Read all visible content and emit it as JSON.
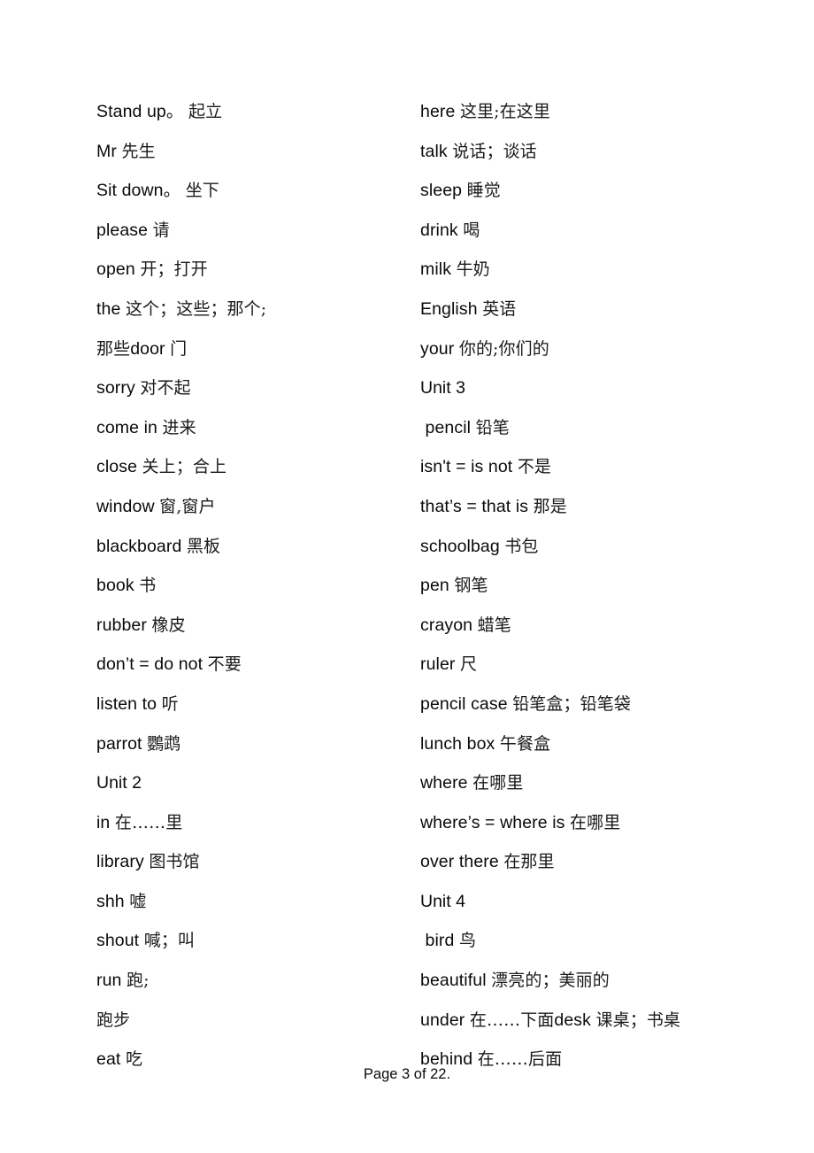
{
  "document": {
    "type": "vocabulary-list",
    "page_label": "Page 3 of 22.",
    "background_color": "#ffffff",
    "text_color": "#000000"
  },
  "columns": {
    "left": {
      "name": "left-column",
      "entries": [
        {
          "en": "Stand up。 ",
          "zh": "起立"
        },
        {
          "en": "Mr ",
          "zh": "先生"
        },
        {
          "en": "Sit down。 ",
          "zh": "坐下"
        },
        {
          "en": "please ",
          "zh": "请"
        },
        {
          "en": "open ",
          "zh": "开；打开"
        },
        {
          "en": "the ",
          "zh": "这个；这些；那个;"
        },
        {
          "en": "",
          "zh": "那些",
          "en2": "door ",
          "zh2": "门"
        },
        {
          "en": "sorry ",
          "zh": "对不起"
        },
        {
          "en": "come in ",
          "zh": "进来"
        },
        {
          "en": "close ",
          "zh": "关上；合上"
        },
        {
          "en": "window ",
          "zh": "窗,窗户"
        },
        {
          "en": "blackboard ",
          "zh": "黑板"
        },
        {
          "en": "book ",
          "zh": "书"
        },
        {
          "en": "rubber ",
          "zh": "橡皮"
        },
        {
          "en": "don’t = do not ",
          "zh": "不要"
        },
        {
          "en": "listen to ",
          "zh": "听"
        },
        {
          "en": "parrot ",
          "zh": "鸚鹉"
        },
        {
          "en": "Unit 2",
          "zh": ""
        },
        {
          "en": "in ",
          "zh": "在……里"
        },
        {
          "en": "library ",
          "zh": "图书馆"
        },
        {
          "en": "shh ",
          "zh": "嘘"
        },
        {
          "en": "shout ",
          "zh": "喊；叫"
        },
        {
          "en": "run ",
          "zh": "跑;"
        },
        {
          "en": "",
          "zh": "跑步"
        },
        {
          "en": "eat ",
          "zh": "吃"
        }
      ]
    },
    "right": {
      "name": "right-column",
      "entries": [
        {
          "en": "here ",
          "zh": "这里;在这里"
        },
        {
          "en": "talk ",
          "zh": "说话；谈话"
        },
        {
          "en": "sleep ",
          "zh": "睡觉"
        },
        {
          "en": "drink ",
          "zh": "喝"
        },
        {
          "en": "milk ",
          "zh": "牛奶"
        },
        {
          "en": "English ",
          "zh": "英语"
        },
        {
          "en": "your ",
          "zh": "你的;你们的"
        },
        {
          "en": "Unit 3",
          "zh": ""
        },
        {
          "en": " pencil ",
          "zh": "铅笔"
        },
        {
          "en": "isn't = is not ",
          "zh": "不是"
        },
        {
          "en": "that’s = that is ",
          "zh": "那是"
        },
        {
          "en": "schoolbag ",
          "zh": "书包"
        },
        {
          "en": "pen ",
          "zh": "钢笔"
        },
        {
          "en": "crayon ",
          "zh": "蜡笔"
        },
        {
          "en": "ruler ",
          "zh": "尺"
        },
        {
          "en": "pencil case ",
          "zh": "铅笔盒；铅笔袋"
        },
        {
          "en": "lunch box ",
          "zh": "午餐盒"
        },
        {
          "en": "where ",
          "zh": "在哪里"
        },
        {
          "en": "where’s = where is ",
          "zh": "在哪里"
        },
        {
          "en": "over there ",
          "zh": "在那里"
        },
        {
          "en": "Unit 4",
          "zh": ""
        },
        {
          "en": " bird ",
          "zh": "鸟"
        },
        {
          "en": "beautiful ",
          "zh": "漂亮的；美丽的"
        },
        {
          "en": "under ",
          "zh": "在……下面",
          "en2": "desk ",
          "zh2": "课桌；书桌"
        },
        {
          "en": "behind ",
          "zh": "在……后面"
        }
      ]
    }
  },
  "footer": {
    "text": "Page 3 of 22."
  }
}
